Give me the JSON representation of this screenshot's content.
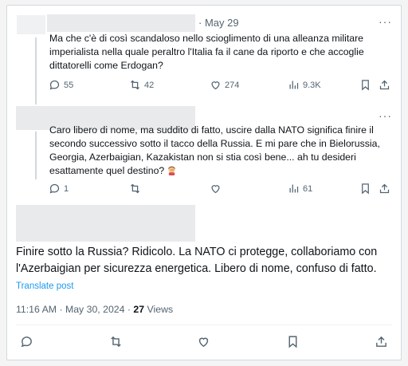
{
  "reply1": {
    "date": "· May 29",
    "more": "···",
    "text": "Ma che c'è di così scandaloso nello scioglimento di una alleanza militare imperialista nella quale peraltro l'Italia fa il cane da riporto e che accoglie dittatorelli come Erdogan?",
    "stats": {
      "replies": "55",
      "reposts": "42",
      "likes": "274",
      "views": "9.3K"
    }
  },
  "reply2": {
    "more": "···",
    "text": "Caro libero di nome, ma suddito di fatto, uscire dalla NATO significa finire il secondo successivo sotto il tacco della Russia. E mi pare che in Bielorussia, Georgia, Azerbaigian, Kazakistan non si stia così bene... ah tu desideri esattamente quel destino?",
    "emoji": "woman-facepalming-emoji",
    "stats": {
      "replies": "1",
      "reposts": "",
      "likes": "",
      "views": "61"
    }
  },
  "main": {
    "text": "Finire sotto la Russia? Ridicolo. La NATO ci protegge, collaboriamo con l'Azerbaigian per sicurezza energetica. Libero di nome, confuso di fatto.",
    "translate": "Translate post",
    "timestamp": "11:16 AM · May 30, 2024 · ",
    "views_count": "27",
    "views_label": " Views"
  },
  "colors": {
    "accent": "#1d9bf0",
    "muted": "#536471",
    "text": "#0f1419",
    "border": "#cfd9de"
  }
}
